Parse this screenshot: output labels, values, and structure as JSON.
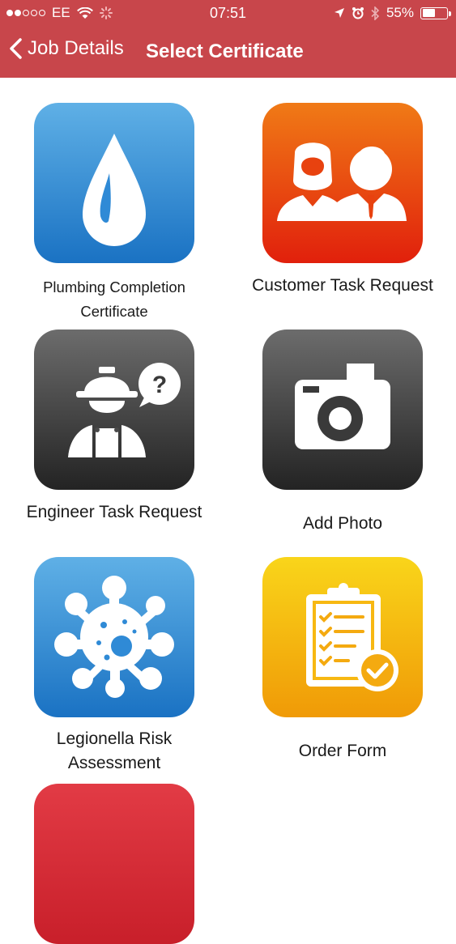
{
  "status_bar": {
    "carrier": "EE",
    "time": "07:51",
    "battery": "55%",
    "battery_level": 0.55,
    "signal_dots_filled": 2,
    "icons": [
      "wifi-icon",
      "loading-icon",
      "location-icon",
      "alarm-icon",
      "bluetooth-icon",
      "battery-icon"
    ]
  },
  "nav": {
    "back_label": "Job Details",
    "title": "Select Certificate"
  },
  "colors": {
    "header": "#c8464b",
    "blue_tile": "#1a72c3",
    "orange_tile": "#e1200c",
    "gray_tile": "#232323",
    "yellow_tile": "#f09a07",
    "red_tile": "#c81f2a"
  },
  "items": [
    {
      "label": "Plumbing Completion Certificate",
      "icon": "water-drop-icon"
    },
    {
      "label": "Customer Task Request",
      "icon": "customers-icon"
    },
    {
      "label": "Engineer Task Request",
      "icon": "engineer-icon"
    },
    {
      "label": "Add Photo",
      "icon": "camera-icon"
    },
    {
      "label": "Legionella Risk Assessment",
      "icon": "bacteria-icon"
    },
    {
      "label": "Order Form",
      "icon": "clipboard-check-icon"
    }
  ]
}
